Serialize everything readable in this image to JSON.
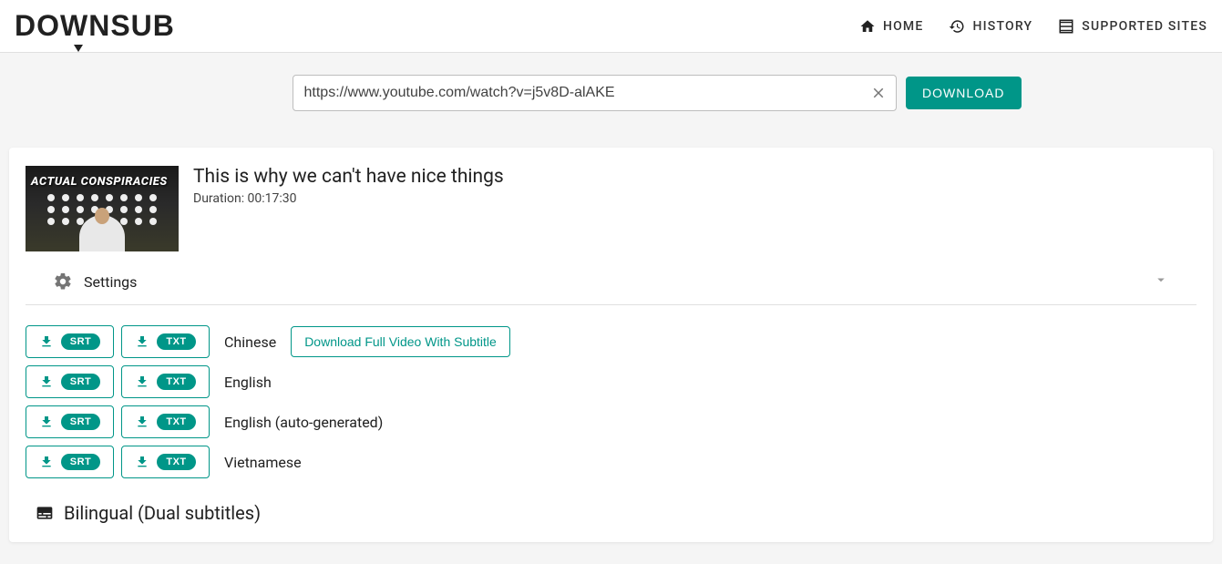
{
  "brand": "DOWNSUB",
  "nav": {
    "home": "HOME",
    "history": "HISTORY",
    "supported": "SUPPORTED SITES"
  },
  "search": {
    "value": "https://www.youtube.com/watch?v=j5v8D-alAKE",
    "download_label": "DOWNLOAD"
  },
  "video": {
    "thumb_overlay": "ACTUAL CONSPIRACIES",
    "title": "This is why we can't have nice things",
    "duration_label": "Duration: 00:17:30"
  },
  "settings_label": "Settings",
  "formats": {
    "srt": "SRT",
    "txt": "TXT"
  },
  "full_video_label": "Download Full Video With Subtitle",
  "languages": [
    {
      "name": "Chinese",
      "show_full": true
    },
    {
      "name": "English",
      "show_full": false
    },
    {
      "name": "English (auto-generated)",
      "show_full": false
    },
    {
      "name": "Vietnamese",
      "show_full": false
    }
  ],
  "bilingual_label": "Bilingual (Dual subtitles)"
}
